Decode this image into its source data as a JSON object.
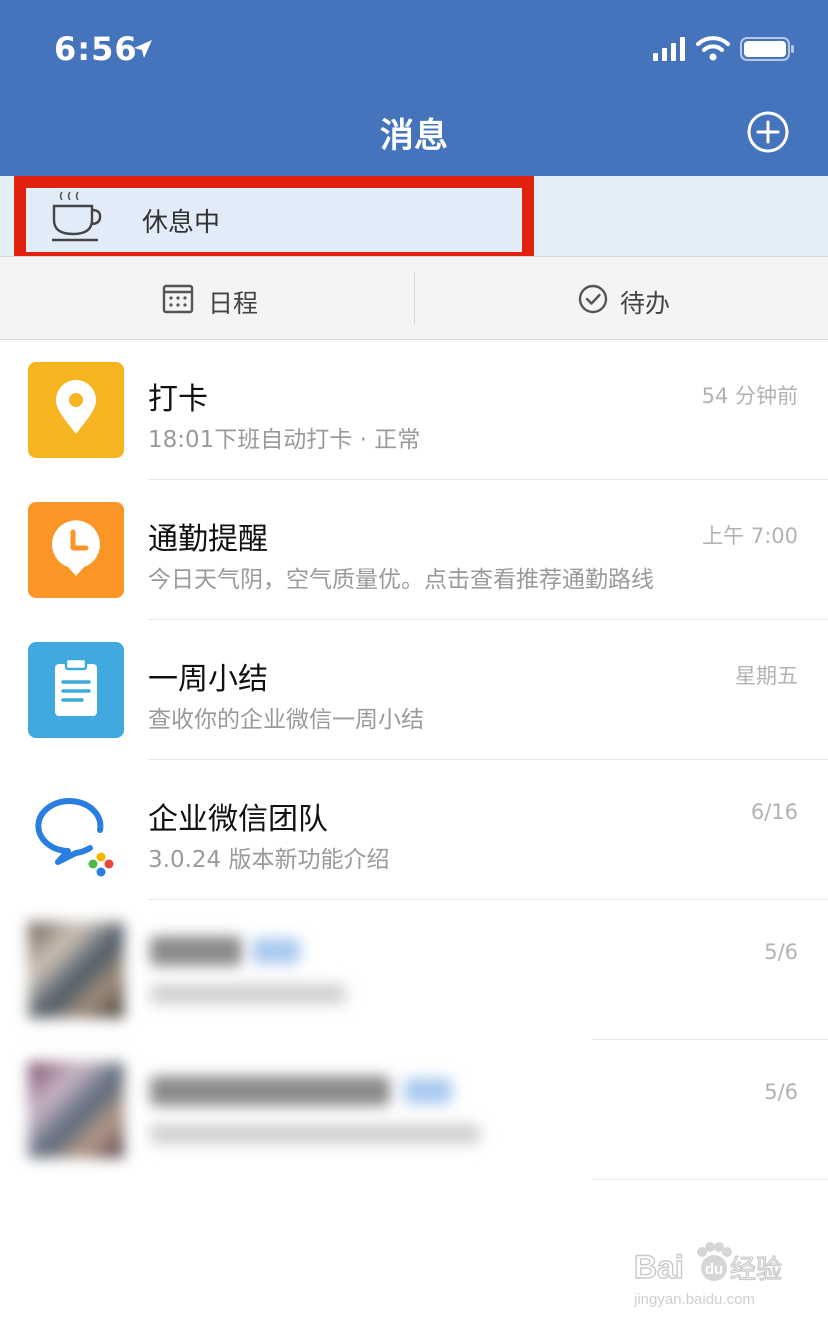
{
  "status_bar": {
    "time": "6:56"
  },
  "header": {
    "title": "消息"
  },
  "status_card": {
    "text": "休息中"
  },
  "tabs": [
    {
      "label": "日程",
      "icon": "calendar-icon"
    },
    {
      "label": "待办",
      "icon": "checkmark-circle-icon"
    }
  ],
  "messages": [
    {
      "name": "打卡",
      "preview": "18:01下班自动打卡 · 正常",
      "time": "54 分钟前",
      "icon": "location-pin-icon",
      "color": "#f6b420"
    },
    {
      "name": "通勤提醒",
      "preview": "今日天气阴，空气质量优。点击查看推荐通勤路线",
      "time": "上午 7:00",
      "icon": "clock-pin-icon",
      "color": "#fa9526"
    },
    {
      "name": "一周小结",
      "preview": "查收你的企业微信一周小结",
      "time": "星期五",
      "icon": "clipboard-icon",
      "color": "#3fa9e0"
    },
    {
      "name": "企业微信团队",
      "preview": "3.0.24 版本新功能介绍",
      "time": "6/16",
      "icon": "wecom-logo-icon",
      "color": "#2a7de1"
    }
  ],
  "blurred_messages": [
    {
      "time": "5/6"
    },
    {
      "time": "5/6"
    }
  ],
  "colors": {
    "header": "#4574bd",
    "highlight": "#e0220f",
    "status_band": "#e4eef8"
  },
  "watermark": {
    "text": "Baidu经验",
    "url": "jingyan.baidu.com"
  }
}
